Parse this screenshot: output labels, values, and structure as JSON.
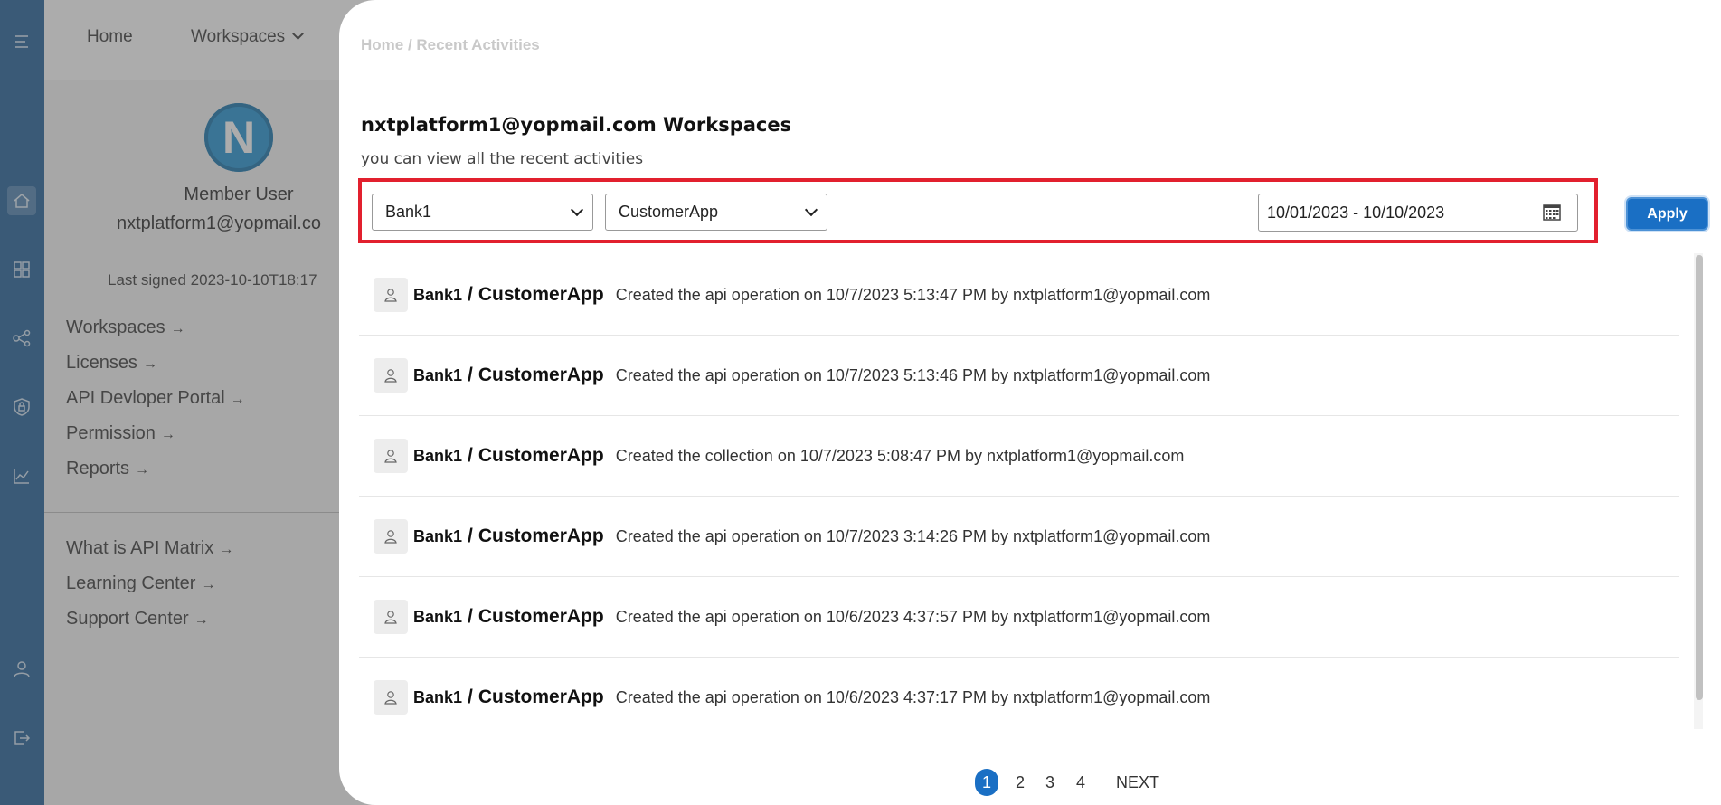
{
  "topnav": {
    "home": "Home",
    "workspaces": "Workspaces"
  },
  "profile": {
    "avatar_letter": "N",
    "role": "Member User",
    "email": "nxtplatform1@yopmail.co",
    "last_signed": "Last signed 2023-10-10T18:17"
  },
  "side_links": [
    {
      "label": "Workspaces",
      "arrow": "→"
    },
    {
      "label": "Licenses",
      "arrow": "→"
    },
    {
      "label": "API Devloper Portal",
      "arrow": "→"
    },
    {
      "label": "Permission",
      "arrow": "→"
    },
    {
      "label": "Reports",
      "arrow": "→"
    },
    {
      "label": "What is API Matrix",
      "arrow": "→"
    },
    {
      "label": "Learning Center",
      "arrow": "→"
    },
    {
      "label": "Support Center",
      "arrow": "→"
    }
  ],
  "rail_icons": [
    "menu-icon",
    "home-icon",
    "dashboard-icon",
    "share-nodes-icon",
    "shield-icon",
    "chart-icon",
    "user-icon",
    "logout-icon"
  ],
  "drawer": {
    "breadcrumb": "Home / Recent Activities",
    "title": "nxtplatform1@yopmail.com Workspaces",
    "subtitle": "you can view all the recent activities",
    "workspace_select": "Bank1",
    "app_select": "CustomerApp",
    "date_range": "10/01/2023 - 10/10/2023",
    "apply_label": "Apply"
  },
  "activities": [
    {
      "workspace": "Bank1",
      "sep": "/",
      "app": "CustomerApp",
      "desc": "Created the api operation on 10/7/2023 5:13:47 PM by nxtplatform1@yopmail.com"
    },
    {
      "workspace": "Bank1",
      "sep": "/",
      "app": "CustomerApp",
      "desc": "Created the api operation on 10/7/2023 5:13:46 PM by nxtplatform1@yopmail.com"
    },
    {
      "workspace": "Bank1",
      "sep": "/",
      "app": "CustomerApp",
      "desc": "Created the collection on 10/7/2023 5:08:47 PM by nxtplatform1@yopmail.com"
    },
    {
      "workspace": "Bank1",
      "sep": "/",
      "app": "CustomerApp",
      "desc": "Created the api operation on 10/7/2023 3:14:26 PM by nxtplatform1@yopmail.com"
    },
    {
      "workspace": "Bank1",
      "sep": "/",
      "app": "CustomerApp",
      "desc": "Created the api operation on 10/6/2023 4:37:57 PM by nxtplatform1@yopmail.com"
    },
    {
      "workspace": "Bank1",
      "sep": "/",
      "app": "CustomerApp",
      "desc": "Created the api operation on 10/6/2023 4:37:17 PM by nxtplatform1@yopmail.com"
    }
  ],
  "pagination": {
    "pages": [
      "1",
      "2",
      "3",
      "4"
    ],
    "active": "1",
    "next": "NEXT"
  },
  "colors": {
    "rail": "#1a5a94",
    "accent": "#1a6fc4",
    "highlight_border": "#e2202e"
  }
}
